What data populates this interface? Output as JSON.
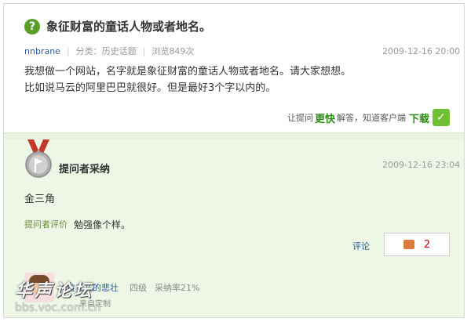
{
  "question": {
    "title": "象征财富的童话人物或者地名。",
    "author": "nnbrane",
    "category": "分类：历史话题",
    "views": "浏览849次",
    "date": "2009-12-16 20:00",
    "body_lines": [
      "我想做一个网站，名字就是象征财富的童话人物或者地名。请大家想想。",
      "比如说马云的阿里巴巴就很好。但是最好3个字以内的。"
    ]
  },
  "promo": {
    "prefix": "让提问",
    "fast": "更快",
    "middle": "解答，知道客户端",
    "download": "下载"
  },
  "answer": {
    "adopted_label": "提问者采纳",
    "date": "2009-12-16 23:04",
    "text": "金三角",
    "eval_label": "提问者评价",
    "eval_text": "勉强像个样。",
    "comment_label": "评论",
    "like_count": "2"
  },
  "answerer": {
    "name": "拉奥孔的悲壮",
    "level": "四级",
    "rate": "采纳率21%",
    "custom": "来自定制"
  },
  "watermark": {
    "text": "华声论坛",
    "url": "bbs.voc.com.cn"
  },
  "colors": {
    "accent_green": "#5a9f2a",
    "answer_bg": "#eef7e6",
    "link_blue": "#2a5a9a"
  }
}
